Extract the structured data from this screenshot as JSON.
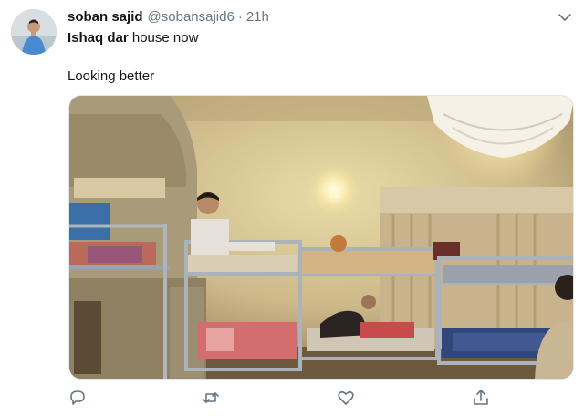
{
  "tweet": {
    "author_name": "soban sajid",
    "author_handle": "@sobansajid6",
    "separator": "·",
    "time": "21h",
    "text_bold": "Ishaq dar",
    "text_rest": " house now",
    "text_line2": "Looking better"
  },
  "icons": {
    "caret": "chevron-down-icon",
    "reply": "reply-icon",
    "retweet": "retweet-icon",
    "like": "heart-icon",
    "share": "share-icon"
  },
  "colors": {
    "text": "#14171a",
    "secondary": "#657786",
    "border": "#e1e8ed"
  }
}
